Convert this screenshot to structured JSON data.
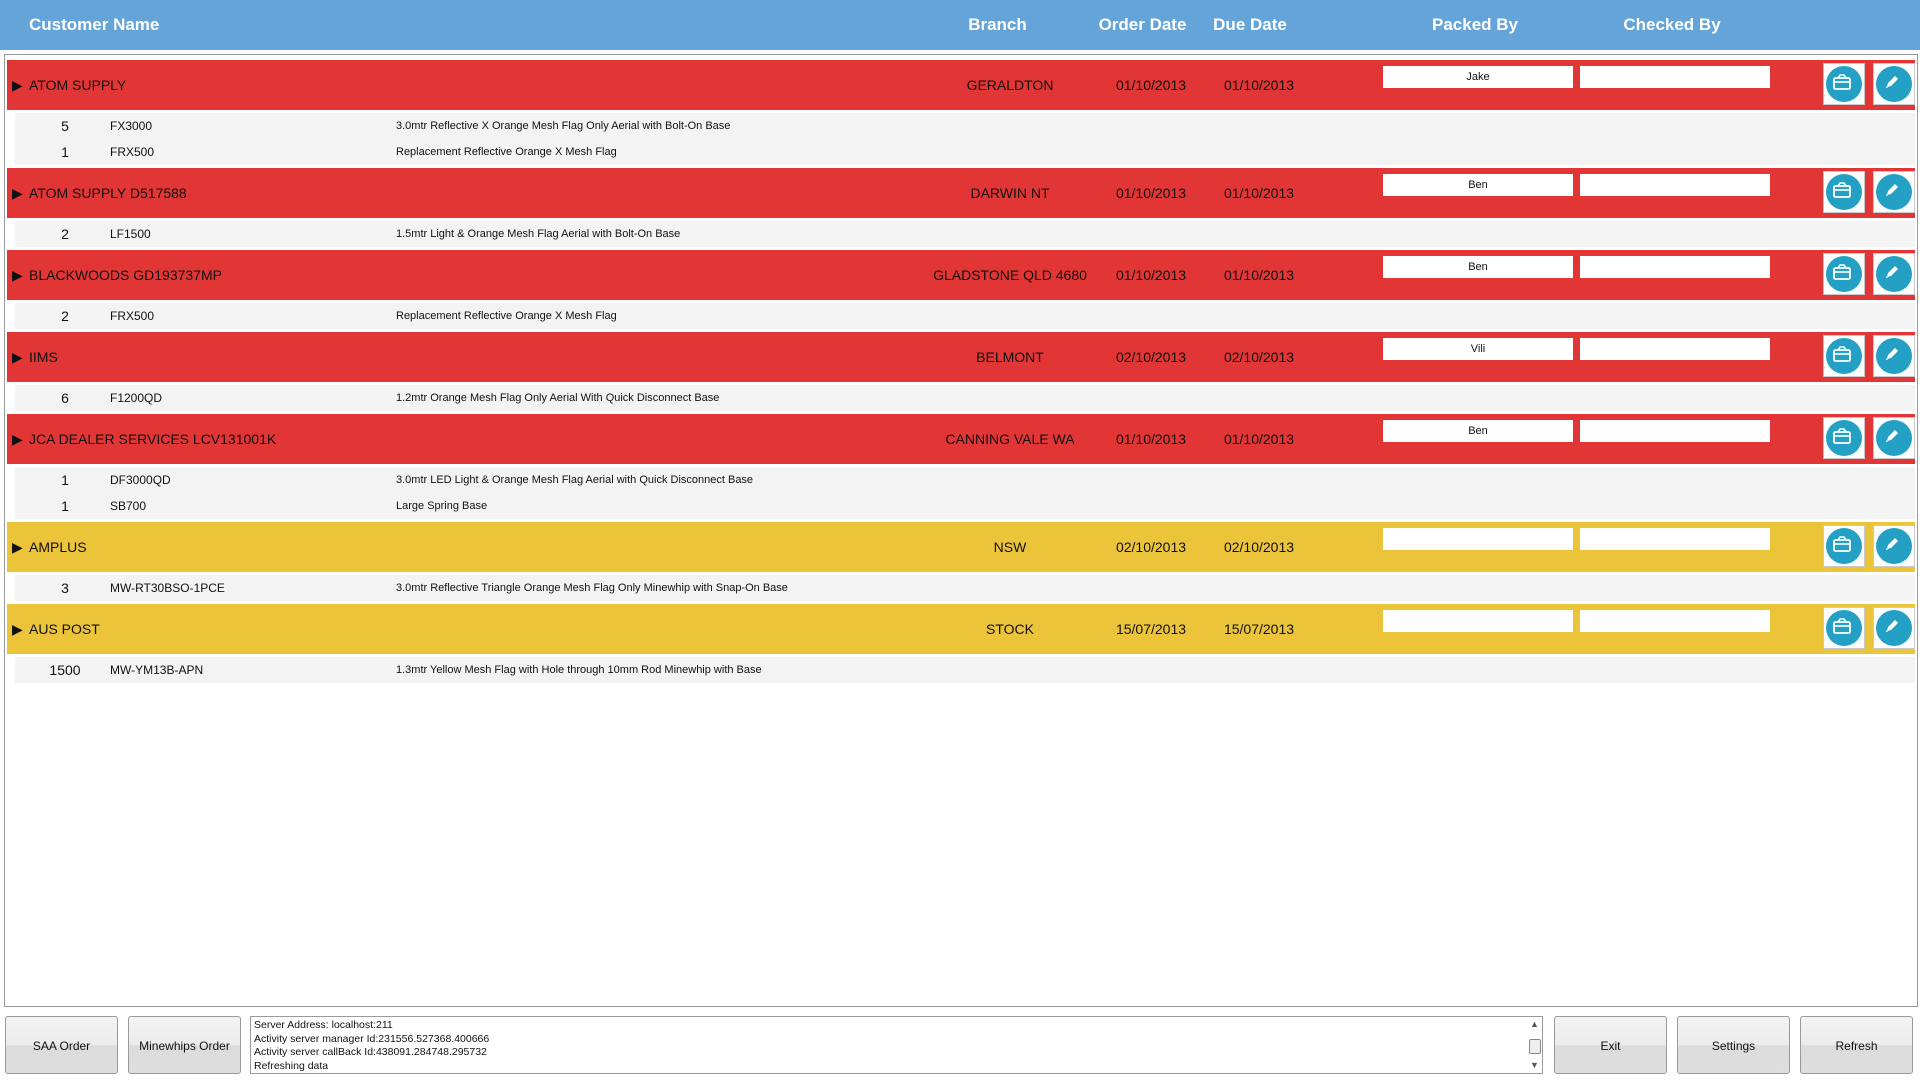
{
  "columns": {
    "customer_name": "Customer Name",
    "branch": "Branch",
    "order_date": "Order Date",
    "due_date": "Due Date",
    "packed_by": "Packed By",
    "checked_by": "Checked By"
  },
  "colors": {
    "header": "#64a4d8",
    "urgent": "#e23535",
    "pending": "#ecc43a",
    "icon_button": "#23a0c4"
  },
  "orders": [
    {
      "status": "urgent",
      "customer": "ATOM SUPPLY",
      "branch": "GERALDTON",
      "order_date": "01/10/2013",
      "due_date": "01/10/2013",
      "packed_by": "Jake",
      "checked_by": "",
      "items": [
        {
          "qty": "5",
          "code": "FX3000",
          "desc": "3.0mtr Reflective X Orange Mesh Flag Only Aerial with Bolt-On Base"
        },
        {
          "qty": "1",
          "code": "FRX500",
          "desc": "Replacement Reflective Orange X Mesh Flag"
        }
      ]
    },
    {
      "status": "urgent",
      "customer": "ATOM SUPPLY  D517588",
      "branch": "DARWIN NT",
      "order_date": "01/10/2013",
      "due_date": "01/10/2013",
      "packed_by": "Ben",
      "checked_by": "",
      "items": [
        {
          "qty": "2",
          "code": "LF1500",
          "desc": "1.5mtr Light & Orange Mesh Flag Aerial with Bolt-On Base"
        }
      ]
    },
    {
      "status": "urgent",
      "customer": "BLACKWOODS  GD193737MP",
      "branch": "GLADSTONE QLD 4680",
      "order_date": "01/10/2013",
      "due_date": "01/10/2013",
      "packed_by": "Ben",
      "checked_by": "",
      "items": [
        {
          "qty": "2",
          "code": "FRX500",
          "desc": "Replacement Reflective Orange X Mesh Flag"
        }
      ]
    },
    {
      "status": "urgent",
      "customer": "IIMS",
      "branch": "BELMONT",
      "order_date": "02/10/2013",
      "due_date": "02/10/2013",
      "packed_by": "Vili",
      "checked_by": "",
      "items": [
        {
          "qty": "6",
          "code": "F1200QD",
          "desc": "1.2mtr Orange Mesh Flag Only Aerial With Quick Disconnect Base"
        }
      ]
    },
    {
      "status": "urgent",
      "customer": "JCA DEALER SERVICES  LCV131001K",
      "branch": "CANNING VALE WA",
      "order_date": "01/10/2013",
      "due_date": "01/10/2013",
      "packed_by": "Ben",
      "checked_by": "",
      "items": [
        {
          "qty": "1",
          "code": "DF3000QD",
          "desc": "3.0mtr LED Light & Orange Mesh Flag Aerial with Quick Disconnect Base"
        },
        {
          "qty": "1",
          "code": "SB700",
          "desc": "Large Spring Base"
        }
      ]
    },
    {
      "status": "pending",
      "customer": "AMPLUS",
      "branch": "NSW",
      "order_date": "02/10/2013",
      "due_date": "02/10/2013",
      "packed_by": "",
      "checked_by": "",
      "items": [
        {
          "qty": "3",
          "code": "MW-RT30BSO-1PCE",
          "desc": "3.0mtr Reflective Triangle Orange Mesh Flag Only Minewhip with Snap-On Base"
        }
      ]
    },
    {
      "status": "pending",
      "customer": "AUS POST",
      "branch": "STOCK",
      "order_date": "15/07/2013",
      "due_date": "15/07/2013",
      "packed_by": "",
      "checked_by": "",
      "items": [
        {
          "qty": "1500",
          "code": "MW-YM13B-APN",
          "desc": "1.3mtr Yellow Mesh Flag with Hole through 10mm Rod Minewhip with Base"
        }
      ]
    }
  ],
  "footer": {
    "saa_order": "SAA Order",
    "minewhips_order": "Minewhips Order",
    "log": [
      "Server Address: localhost:211",
      "Activity server manager Id:231556.527368.400666",
      "Activity server callBack Id:438091.284748.295732",
      "Refreshing data"
    ],
    "exit": "Exit",
    "settings": "Settings",
    "refresh": "Refresh"
  }
}
